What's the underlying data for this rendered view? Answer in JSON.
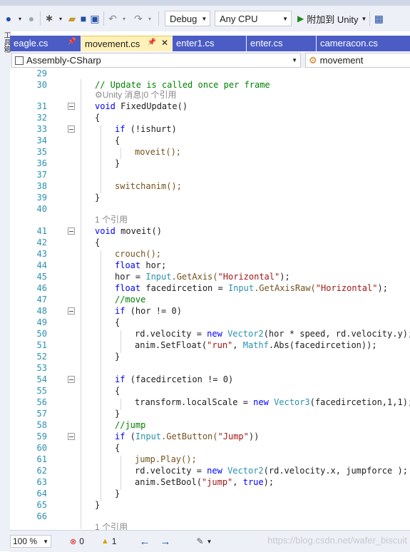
{
  "toolbar": {
    "config": "Debug",
    "platform": "Any CPU",
    "attach_label": "附加到 Unity",
    "left_strip_text": "工具箱"
  },
  "tabs": [
    {
      "label": "eagle.cs",
      "pin": "📌"
    },
    {
      "label": "movement.cs",
      "pin": "📌",
      "close": "✕"
    },
    {
      "label": "enter1.cs"
    },
    {
      "label": "enter.cs"
    },
    {
      "label": "cameracon.cs"
    }
  ],
  "nav": {
    "project": "Assembly-CSharp",
    "class": "movement"
  },
  "status": {
    "zoom": "100 %",
    "errors": "0",
    "warnings": "1",
    "watermark": "https://blog.csdn.net/wafer_biscuit"
  },
  "codelens": {
    "unity_msg": "⚙Unity 消息|0 个引用",
    "ref1": "1 个引用"
  },
  "code": {
    "l29": "",
    "l30": "// Update is called once per frame",
    "l31_kw": "void",
    "l31_rest": " FixedUpdate()",
    "l32": "{",
    "l33_kw": "if",
    "l33_rest": " (!ishurt)",
    "l34": "{",
    "l35": "moveit();",
    "l36": "}",
    "l37": "",
    "l38": "switchanim();",
    "l39": "}",
    "l40": "",
    "l41_kw": "void",
    "l41_rest": " moveit()",
    "l42": "{",
    "l43": "crouch();",
    "l44_kw": "float",
    "l44_rest": " hor;",
    "l45_a": "hor = ",
    "l45_ty": "Input",
    "l45_b": ".GetAxis(",
    "l45_st": "\"Horizontal\"",
    "l45_c": ");",
    "l46_kw": "float",
    "l46_a": " facedircetion = ",
    "l46_ty": "Input",
    "l46_b": ".GetAxisRaw(",
    "l46_st": "\"Horizontal\"",
    "l46_c": ");",
    "l47": "//move",
    "l48_kw": "if",
    "l48_rest": " (hor != 0)",
    "l49": "{",
    "l50_a": "rd.velocity = ",
    "l50_kw": "new",
    "l50_ty": " Vector2",
    "l50_b": "(hor * speed, rd.velocity.y);",
    "l51_a": "anim.SetFloat(",
    "l51_st": "\"run\"",
    "l51_b": ", ",
    "l51_ty": "Mathf",
    "l51_c": ".Abs(facedircetion));",
    "l52": "}",
    "l53": "",
    "l54_kw": "if",
    "l54_rest": " (facedircetion != 0)",
    "l55": "{",
    "l56_a": "transform.localScale = ",
    "l56_kw": "new",
    "l56_ty": " Vector3",
    "l56_b": "(facedircetion,1,1);",
    "l57": "}",
    "l58": "//jump",
    "l59_kw": "if",
    "l59_a": " (",
    "l59_ty": "Input",
    "l59_b": ".GetButton(",
    "l59_st": "\"Jump\"",
    "l59_c": "))",
    "l60": "{",
    "l61": "jump.Play();",
    "l62_a": "rd.velocity = ",
    "l62_kw": "new",
    "l62_ty": " Vector2",
    "l62_b": "(rd.velocity.x, jumpforce );",
    "l63_a": "anim.SetBool(",
    "l63_st": "\"jump\"",
    "l63_b": ", ",
    "l63_kw": "true",
    "l63_c": ");",
    "l64": "}",
    "l65": "}",
    "l66": ""
  },
  "line_numbers": [
    "29",
    "30",
    "31",
    "32",
    "33",
    "34",
    "35",
    "36",
    "37",
    "38",
    "39",
    "40",
    "41",
    "42",
    "43",
    "44",
    "45",
    "46",
    "47",
    "48",
    "49",
    "50",
    "51",
    "52",
    "53",
    "54",
    "55",
    "56",
    "57",
    "58",
    "59",
    "60",
    "61",
    "62",
    "63",
    "64",
    "65",
    "66"
  ]
}
